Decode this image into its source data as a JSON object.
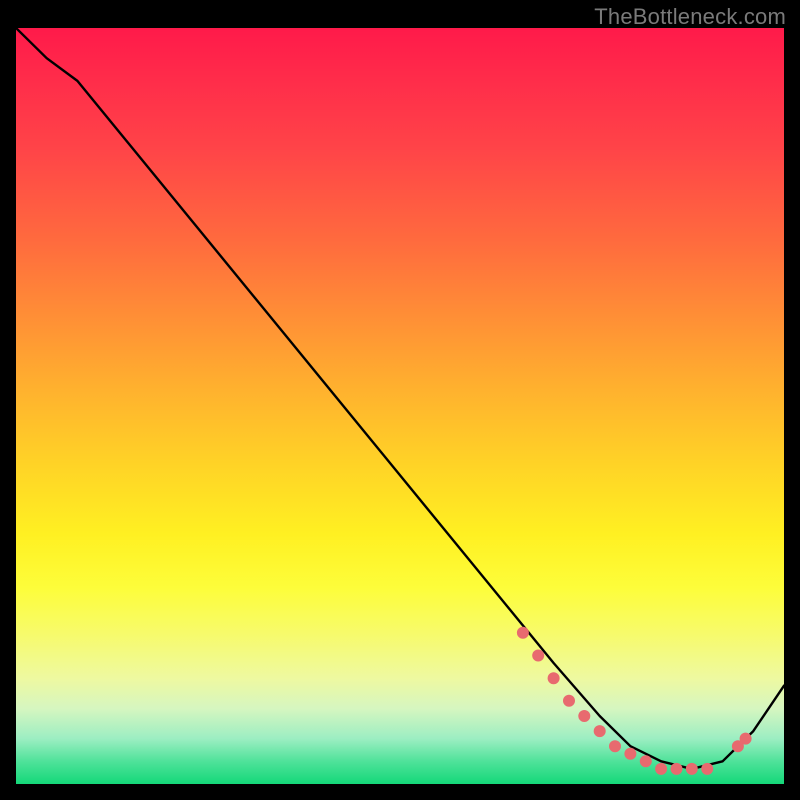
{
  "watermark": "TheBottleneck.com",
  "chart_data": {
    "type": "line",
    "title": "",
    "xlabel": "",
    "ylabel": "",
    "xlim": [
      0,
      100
    ],
    "ylim": [
      0,
      100
    ],
    "series": [
      {
        "name": "curve",
        "x": [
          0,
          4,
          8,
          70,
          76,
          80,
          84,
          88,
          92,
          96,
          100
        ],
        "y": [
          100,
          96,
          93,
          16,
          9,
          5,
          3,
          2,
          3,
          7,
          13
        ]
      }
    ],
    "markers": {
      "x": [
        66,
        68,
        70,
        72,
        74,
        76,
        78,
        80,
        82,
        84,
        86,
        88,
        90,
        94,
        95
      ],
      "y": [
        20,
        17,
        14,
        11,
        9,
        7,
        5,
        4,
        3,
        2,
        2,
        2,
        2,
        5,
        6
      ]
    }
  }
}
